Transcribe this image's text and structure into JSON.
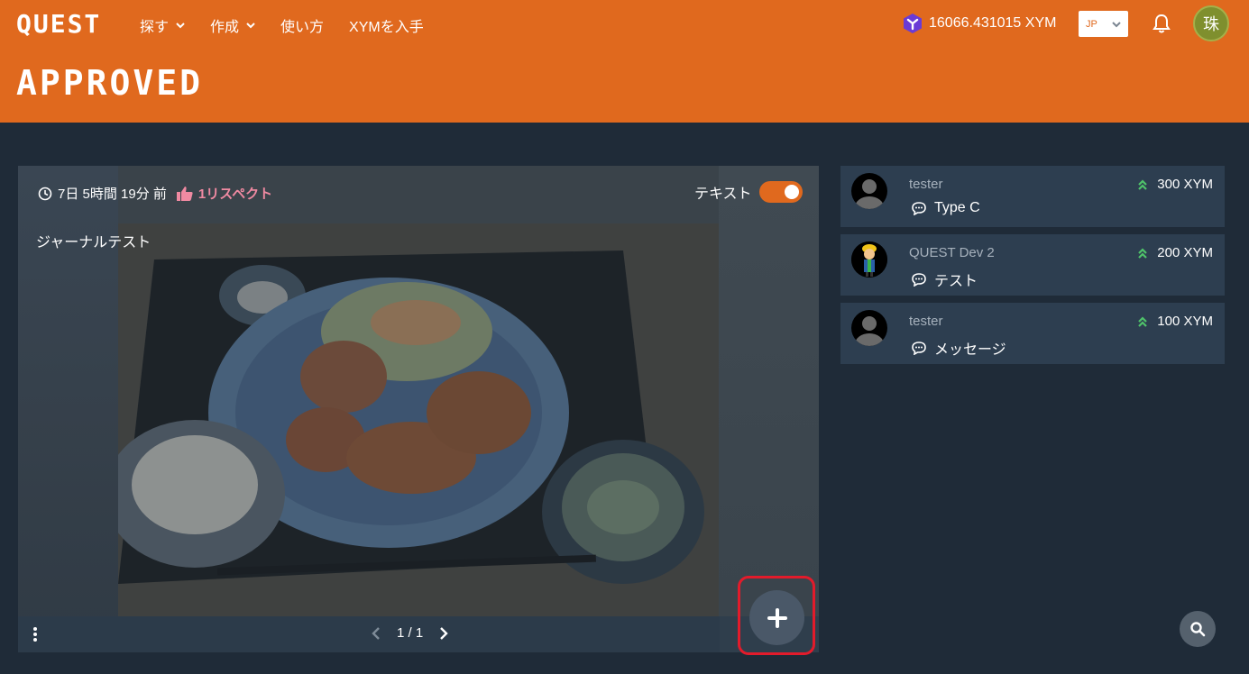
{
  "header": {
    "logo": "QUEST",
    "nav": [
      {
        "label": "探す",
        "has_dropdown": true
      },
      {
        "label": "作成",
        "has_dropdown": true
      },
      {
        "label": "使い方",
        "has_dropdown": false
      },
      {
        "label": "XYMを入手",
        "has_dropdown": false
      }
    ],
    "balance": "16066.431015 XYM",
    "language": "JP",
    "avatar_char": "珠",
    "page_title": "APPROVED"
  },
  "journal": {
    "time_ago": "7日 5時間 19分 前",
    "respect": "1リスペクト",
    "toggle_label": "テキスト",
    "toggle_on": true,
    "text": "ジャーナルテスト",
    "page": "1 / 1"
  },
  "tips": [
    {
      "user": "tester",
      "amount": "300 XYM",
      "message": "Type C",
      "avatar": "default-avatar"
    },
    {
      "user": "QUEST Dev 2",
      "amount": "200 XYM",
      "message": "テスト",
      "avatar": "character-avatar"
    },
    {
      "user": "tester",
      "amount": "100 XYM",
      "message": "メッセージ",
      "avatar": "default-avatar"
    }
  ],
  "colors": {
    "brand": "#e0691e",
    "background": "#1f2b38",
    "respect": "#f08aa2",
    "highlight": "#e21b2b",
    "up_arrow": "#4fc36a"
  }
}
